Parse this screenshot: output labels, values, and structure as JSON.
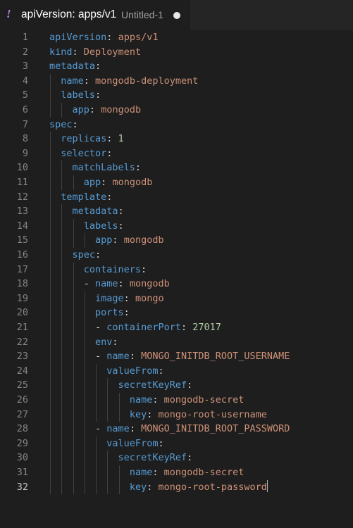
{
  "tab": {
    "icon": "!",
    "title": "apiVersion: apps/v1",
    "description": "Untitled-1",
    "dirty": true
  },
  "colors": {
    "key": "#569cd6",
    "string": "#ce9178",
    "number": "#b5cea8",
    "icon": "#b180d7"
  },
  "editor": {
    "active_line": 32,
    "lines": [
      {
        "n": "1",
        "indent": 0,
        "dash": false,
        "key": "apiVersion",
        "value": "apps/v1",
        "vtype": "s"
      },
      {
        "n": "2",
        "indent": 0,
        "dash": false,
        "key": "kind",
        "value": "Deployment",
        "vtype": "s"
      },
      {
        "n": "3",
        "indent": 0,
        "dash": false,
        "key": "metadata",
        "value": "",
        "vtype": "s"
      },
      {
        "n": "4",
        "indent": 1,
        "dash": false,
        "key": "name",
        "value": "mongodb-deployment",
        "vtype": "s"
      },
      {
        "n": "5",
        "indent": 1,
        "dash": false,
        "key": "labels",
        "value": "",
        "vtype": "s"
      },
      {
        "n": "6",
        "indent": 2,
        "dash": false,
        "key": "app",
        "value": "mongodb",
        "vtype": "s"
      },
      {
        "n": "7",
        "indent": 0,
        "dash": false,
        "key": "spec",
        "value": "",
        "vtype": "s"
      },
      {
        "n": "8",
        "indent": 1,
        "dash": false,
        "key": "replicas",
        "value": "1",
        "vtype": "n"
      },
      {
        "n": "9",
        "indent": 1,
        "dash": false,
        "key": "selector",
        "value": "",
        "vtype": "s"
      },
      {
        "n": "10",
        "indent": 2,
        "dash": false,
        "key": "matchLabels",
        "value": "",
        "vtype": "s"
      },
      {
        "n": "11",
        "indent": 3,
        "dash": false,
        "key": "app",
        "value": "mongodb",
        "vtype": "s"
      },
      {
        "n": "12",
        "indent": 1,
        "dash": false,
        "key": "template",
        "value": "",
        "vtype": "s"
      },
      {
        "n": "13",
        "indent": 2,
        "dash": false,
        "key": "metadata",
        "value": "",
        "vtype": "s"
      },
      {
        "n": "14",
        "indent": 3,
        "dash": false,
        "key": "labels",
        "value": "",
        "vtype": "s"
      },
      {
        "n": "15",
        "indent": 4,
        "dash": false,
        "key": "app",
        "value": "mongodb",
        "vtype": "s"
      },
      {
        "n": "16",
        "indent": 2,
        "dash": false,
        "key": "spec",
        "value": "",
        "vtype": "s"
      },
      {
        "n": "17",
        "indent": 3,
        "dash": false,
        "key": "containers",
        "value": "",
        "vtype": "s"
      },
      {
        "n": "18",
        "indent": 3,
        "dash": true,
        "key": "name",
        "value": "mongodb",
        "vtype": "s"
      },
      {
        "n": "19",
        "indent": 4,
        "dash": false,
        "key": "image",
        "value": "mongo",
        "vtype": "s"
      },
      {
        "n": "20",
        "indent": 4,
        "dash": false,
        "key": "ports",
        "value": "",
        "vtype": "s"
      },
      {
        "n": "21",
        "indent": 4,
        "dash": true,
        "key": "containerPort",
        "value": "27017",
        "vtype": "n"
      },
      {
        "n": "22",
        "indent": 4,
        "dash": false,
        "key": "env",
        "value": "",
        "vtype": "s"
      },
      {
        "n": "23",
        "indent": 4,
        "dash": true,
        "key": "name",
        "value": "MONGO_INITDB_ROOT_USERNAME",
        "vtype": "s"
      },
      {
        "n": "24",
        "indent": 5,
        "dash": false,
        "key": "valueFrom",
        "value": "",
        "vtype": "s"
      },
      {
        "n": "25",
        "indent": 6,
        "dash": false,
        "key": "secretKeyRef",
        "value": "",
        "vtype": "s"
      },
      {
        "n": "26",
        "indent": 7,
        "dash": false,
        "key": "name",
        "value": "mongodb-secret",
        "vtype": "s"
      },
      {
        "n": "27",
        "indent": 7,
        "dash": false,
        "key": "key",
        "value": "mongo-root-username",
        "vtype": "s"
      },
      {
        "n": "28",
        "indent": 4,
        "dash": true,
        "key": "name",
        "value": "MONGO_INITDB_ROOT_PASSWORD",
        "vtype": "s"
      },
      {
        "n": "29",
        "indent": 5,
        "dash": false,
        "key": "valueFrom",
        "value": "",
        "vtype": "s"
      },
      {
        "n": "30",
        "indent": 6,
        "dash": false,
        "key": "secretKeyRef",
        "value": "",
        "vtype": "s"
      },
      {
        "n": "31",
        "indent": 7,
        "dash": false,
        "key": "name",
        "value": "mongodb-secret",
        "vtype": "s"
      },
      {
        "n": "32",
        "indent": 7,
        "dash": false,
        "key": "key",
        "value": "mongo-root-password",
        "vtype": "s"
      }
    ]
  }
}
